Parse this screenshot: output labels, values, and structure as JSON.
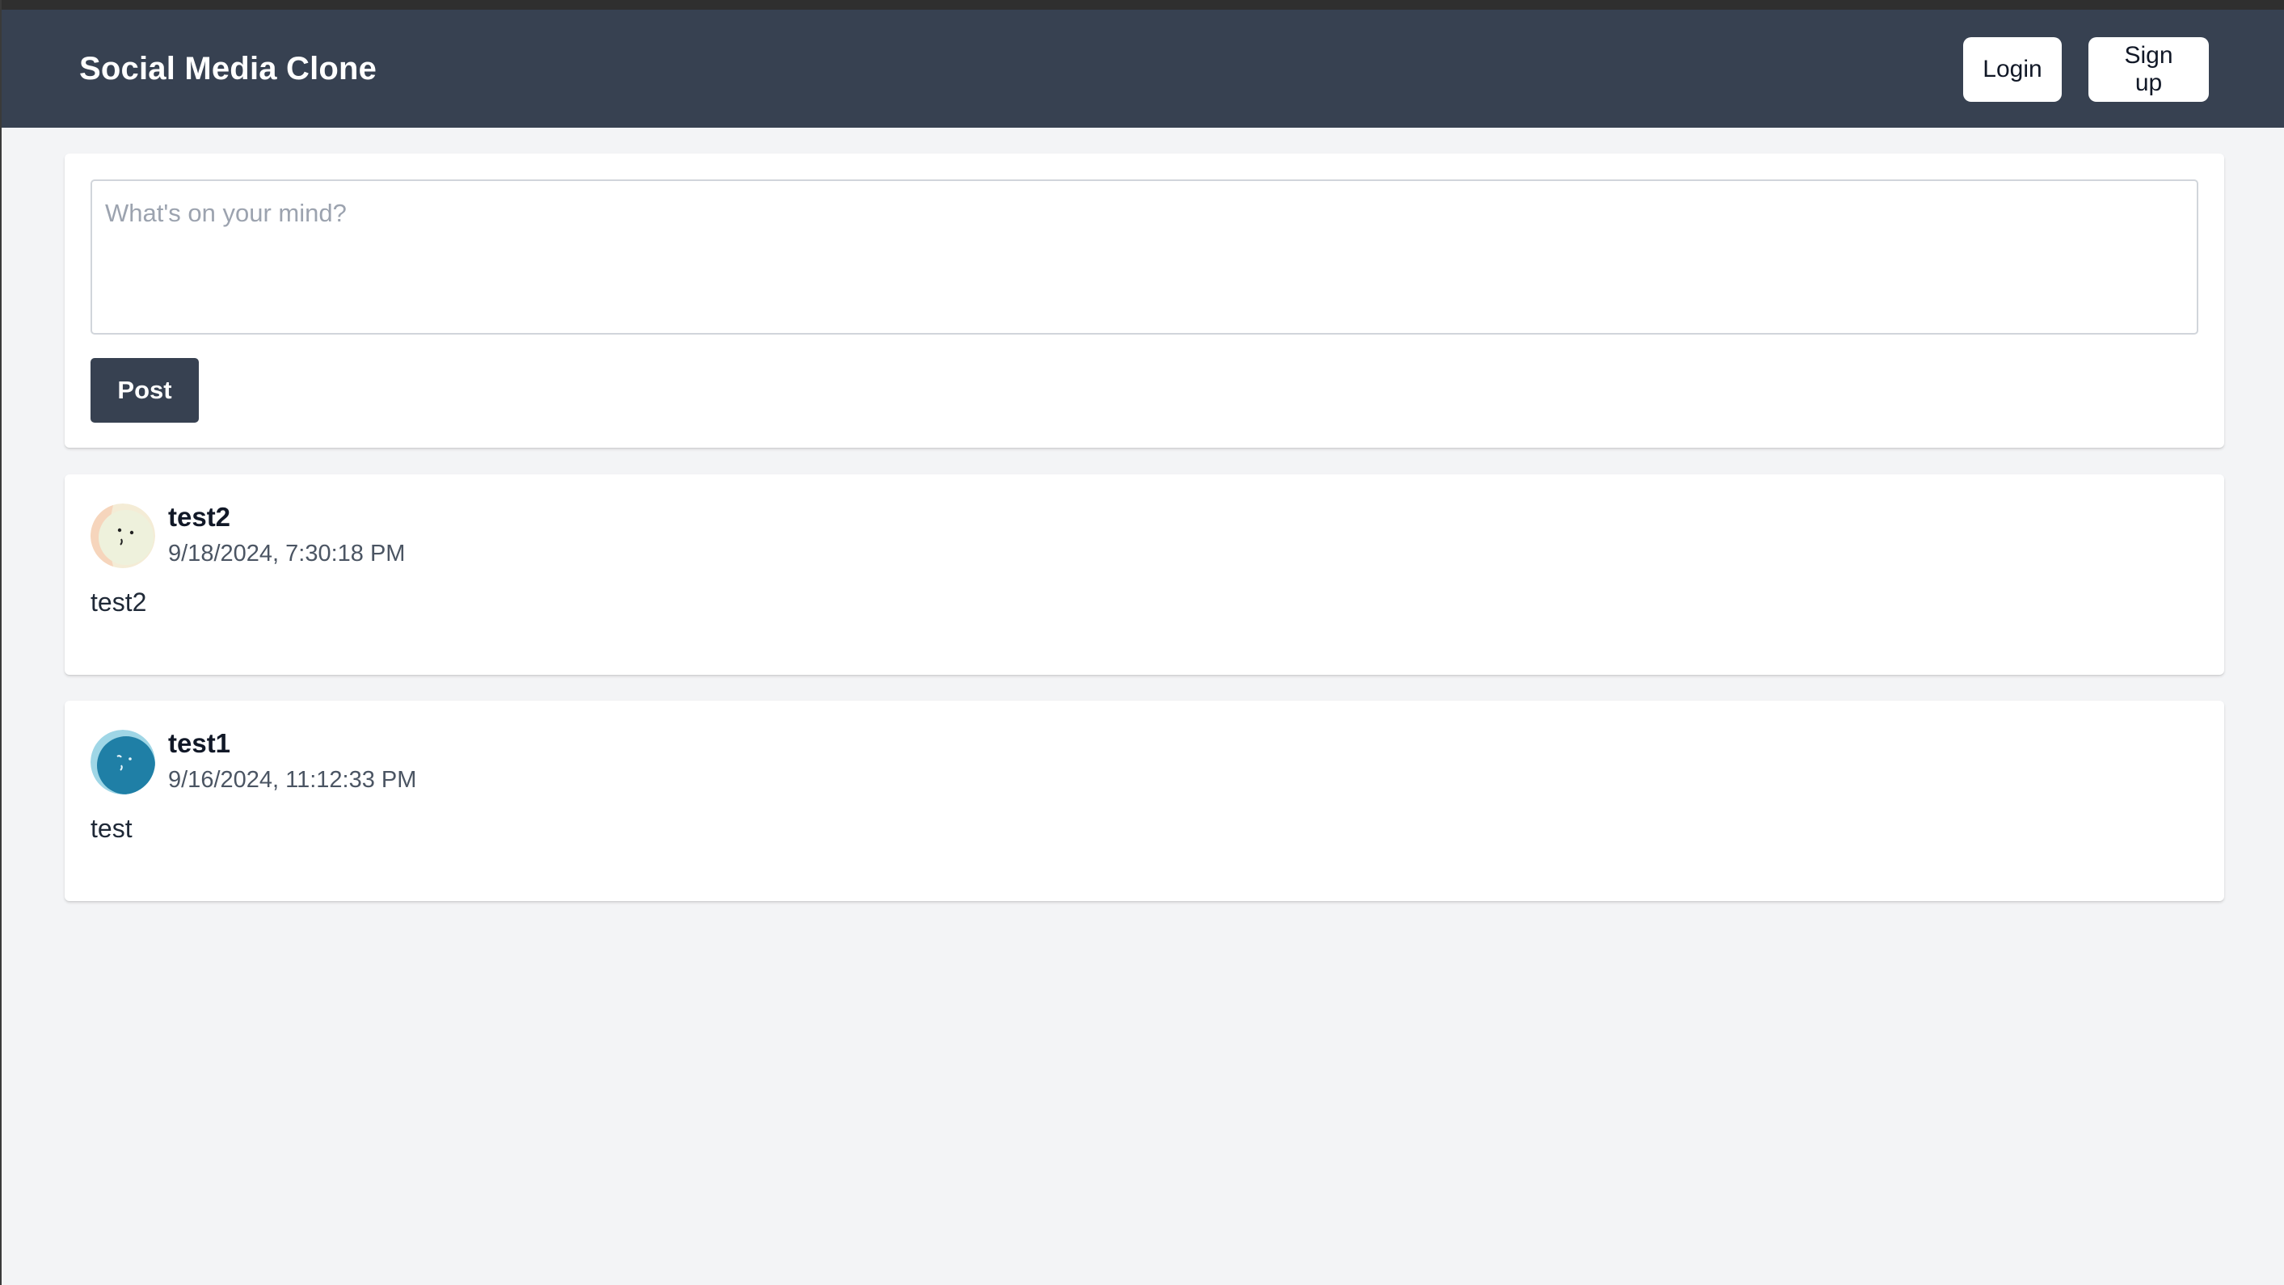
{
  "app": {
    "title": "Social Media Clone"
  },
  "nav": {
    "login_label": "Login",
    "signup_label": "Sign up"
  },
  "composer": {
    "placeholder": "What's on your mind?",
    "value": "",
    "post_label": "Post"
  },
  "posts": [
    {
      "author": "test2",
      "timestamp": "9/18/2024, 7:30:18 PM",
      "content": "test2",
      "avatar_icon": "avatar-cream-icon"
    },
    {
      "author": "test1",
      "timestamp": "9/16/2024, 11:12:33 PM",
      "content": "test",
      "avatar_icon": "avatar-teal-icon"
    }
  ],
  "colors": {
    "navbar": "#374151",
    "background": "#f3f4f6",
    "post_button": "#374151",
    "card": "#ffffff"
  }
}
